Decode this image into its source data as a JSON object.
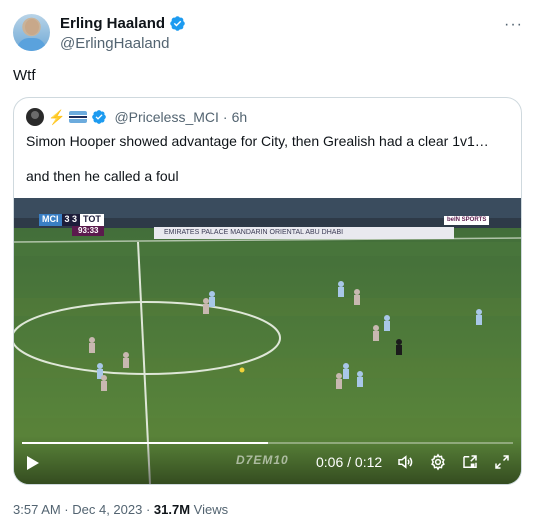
{
  "author": {
    "display_name": "Erling Haaland",
    "handle": "@ErlingHaaland",
    "verified_icon": "verified-badge-icon"
  },
  "more_icon_label": "···",
  "tweet": {
    "text": "Wtf"
  },
  "quoted_tweet": {
    "handle": "@Priceless_MCI",
    "separator": "·",
    "time": "6h",
    "line1": "Simon Hooper showed advantage for City, then Grealish had a clear 1v1…",
    "line2": "and then he called a foul"
  },
  "video": {
    "scoreboard": {
      "home": "MCI",
      "score": "3 3",
      "away": "TOT",
      "clock": "93:33"
    },
    "board_text": "EMIRATES  PALACE  MANDARIN  ORIENTAL  ABU  DHABI",
    "broadcaster": "beIN SPORTS",
    "watermark": "D7EM10",
    "current_time": "0:06",
    "duration": "0:12",
    "timecode": "0:06 / 0:12",
    "progress": 0.5
  },
  "footer": {
    "timestamp": "3:57 AM · Dec 4, 2023 · ",
    "views_count": "31.7M",
    "views_label": " Views"
  },
  "colors": {
    "verified": "#1d9bf0",
    "text_primary": "#0f1419",
    "text_secondary": "#536471",
    "border": "#cfd9de"
  }
}
